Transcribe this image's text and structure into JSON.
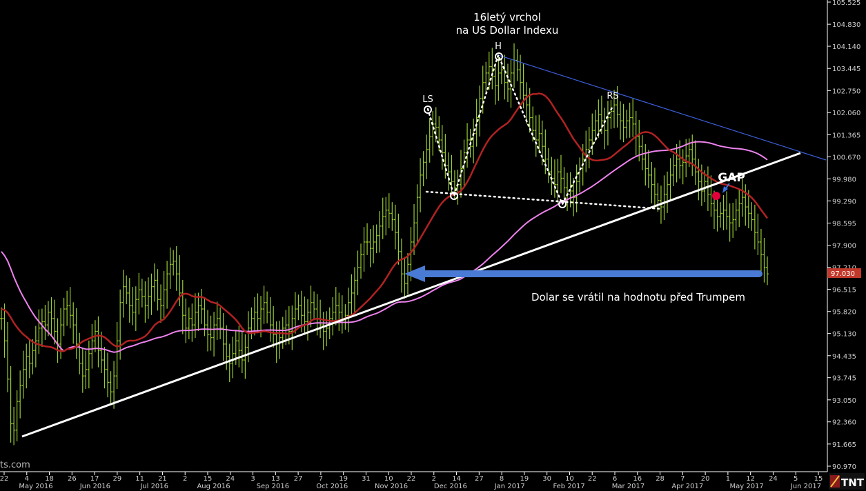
{
  "chart_data": {
    "type": "bar",
    "subtype": "ohlc",
    "series": [
      {
        "name": "",
        "values": [
          95.6,
          94.9,
          93.7,
          92.3,
          92.1,
          93.0,
          93.5,
          94.0,
          94.4,
          94.2,
          94.6,
          94.9,
          95.3,
          95.5,
          95.4,
          95.8,
          95.6,
          95.2,
          94.8,
          95.4,
          95.9,
          96.0,
          95.7,
          95.4,
          94.8,
          94.2,
          93.8,
          94.0,
          94.5,
          94.9,
          95.2,
          94.6,
          94.3,
          94.0,
          93.6,
          93.3,
          93.8,
          94.9,
          96.1,
          96.6,
          96.4,
          96.0,
          95.8,
          96.2,
          96.5,
          96.3,
          96.0,
          96.3,
          96.6,
          96.8,
          96.2,
          96.0,
          96.5,
          97.0,
          97.3,
          97.4,
          97.0,
          96.4,
          95.7,
          95.3,
          95.6,
          95.4,
          95.8,
          96.0,
          95.9,
          95.4,
          95.1,
          95.0,
          95.4,
          95.6,
          95.3,
          94.8,
          94.4,
          94.2,
          94.5,
          94.9,
          94.6,
          94.3,
          94.7,
          95.3,
          95.6,
          95.8,
          95.6,
          95.9,
          96.1,
          95.8,
          95.4,
          95.1,
          94.8,
          95.0,
          95.3,
          95.4,
          95.2,
          95.6,
          95.9,
          96.0,
          95.7,
          95.5,
          95.8,
          96.1,
          95.9,
          95.6,
          95.4,
          95.2,
          95.3,
          95.6,
          95.8,
          96.0,
          95.8,
          95.6,
          95.7,
          96.1,
          96.4,
          96.8,
          97.2,
          97.6,
          98.0,
          98.0,
          97.8,
          98.0,
          98.2,
          98.5,
          98.8,
          99.0,
          98.9,
          98.7,
          98.3,
          97.7,
          97.0,
          96.7,
          97.3,
          98.0,
          98.6,
          99.4,
          100.1,
          100.5,
          100.9,
          101.3,
          101.7,
          101.6,
          101.2,
          100.8,
          100.4,
          100.2,
          99.9,
          99.7,
          99.8,
          100.3,
          100.8,
          101.2,
          101.0,
          101.4,
          101.9,
          102.5,
          103.0,
          103.3,
          103.5,
          103.2,
          102.9,
          103.3,
          103.4,
          103.0,
          102.8,
          103.3,
          103.7,
          103.4,
          103.0,
          102.6,
          102.3,
          101.9,
          101.5,
          101.2,
          101.4,
          101.0,
          100.6,
          100.2,
          100.0,
          99.8,
          100.2,
          100.0,
          99.7,
          99.5,
          99.6,
          99.4,
          99.9,
          100.3,
          100.6,
          100.9,
          101.2,
          101.5,
          101.8,
          102.0,
          101.8,
          101.5,
          101.9,
          102.1,
          102.3,
          102.0,
          101.8,
          101.6,
          101.8,
          101.9,
          101.7,
          101.3,
          101.0,
          100.6,
          100.3,
          100.1,
          99.8,
          99.5,
          99.3,
          99.1,
          99.5,
          99.8,
          100.1,
          100.4,
          100.6,
          100.4,
          100.5,
          100.7,
          100.9,
          100.6,
          100.2,
          99.9,
          99.6,
          99.9,
          99.5,
          99.2,
          99.0,
          98.8,
          98.9,
          99.0,
          98.8,
          98.6,
          98.7,
          99.0,
          99.2,
          99.4,
          99.1,
          98.9,
          98.7,
          98.3,
          98.0,
          97.6,
          97.2,
          97.0
        ]
      }
    ],
    "x_ticks": [
      "22",
      "4",
      "18",
      "26",
      "17",
      "29",
      "11",
      "21",
      "2",
      "15",
      "24",
      "3",
      "13",
      "27",
      "7",
      "19",
      "31",
      "10",
      "22",
      "2",
      "14",
      "27",
      "8",
      "19",
      "30",
      "10",
      "22",
      "6",
      "16",
      "28",
      "7",
      "20",
      "1",
      "12",
      "24",
      "5",
      "15"
    ],
    "month_labels": [
      "May 2016",
      "Jun 2016",
      "Jul 2016",
      "Aug 2016",
      "Sep 2016",
      "Oct 2016",
      "Nov 2016",
      "Dec 2016",
      "Jan 2017",
      "Feb 2017",
      "Mar 2017",
      "Apr 2017",
      "May 2017",
      "Jun 2017"
    ],
    "y_ticks": [
      "105.525",
      "104.830",
      "104.140",
      "103.445",
      "102.750",
      "102.060",
      "101.365",
      "100.670",
      "99.980",
      "99.290",
      "98.595",
      "97.900",
      "97.210",
      "96.515",
      "95.820",
      "95.130",
      "94.435",
      "93.745",
      "93.050",
      "92.360",
      "91.665",
      "90.970"
    ],
    "ylim": [
      90.97,
      105.525
    ],
    "last_price_label": "97.030",
    "annotations": {
      "title": "16letý vrchol na US Dollar Indexu",
      "title_line1": "16letý vrchol",
      "title_line2": "na US Dollar Indexu",
      "ls": "LS",
      "h": "H",
      "rs": "RS",
      "gap": "GAP",
      "arrow_note": "Dolar se vrátil na hodnotu před Trumpem"
    },
    "watermark": "ts.com",
    "logo": "TNT",
    "grid": false,
    "colors": {
      "price_bars": "#9acd32",
      "ma_short": "#b22222",
      "ma_long": "#ee82ee",
      "trendline": "#ffffff",
      "resistance": "#4169e1",
      "arrow": "#4a7bd4",
      "gap_dot": "#e0003a",
      "price_box": "#c0392b"
    }
  }
}
